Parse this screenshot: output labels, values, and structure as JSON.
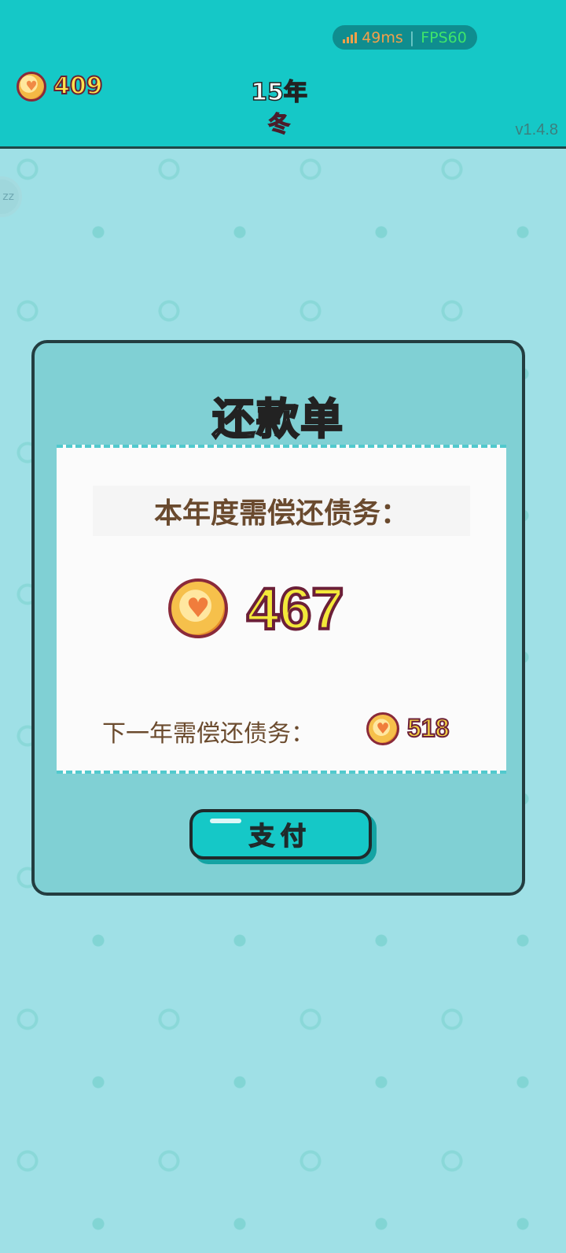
{
  "status": {
    "ping": "49ms",
    "separator": "|",
    "fps": "FPS60"
  },
  "header": {
    "coins": "409",
    "year": "15年",
    "season": "冬",
    "version": "v1.4.8"
  },
  "side": {
    "sleep_label": "zz"
  },
  "dialog": {
    "title": "还款单",
    "this_year_label": "本年度需偿还债务：",
    "this_year_amount": "467",
    "next_year_label": "下一年需偿还债务：",
    "next_year_amount": "518",
    "pay_label": "支付"
  },
  "colors": {
    "teal": "#15c8c7",
    "background": "#9fe0e6",
    "dialog": "#80d0d4",
    "coin_text": "#f3e83a",
    "season": "#ff4f8d"
  },
  "icons": {
    "coin": "heart-coin-icon",
    "signal": "signal-bars-icon"
  }
}
